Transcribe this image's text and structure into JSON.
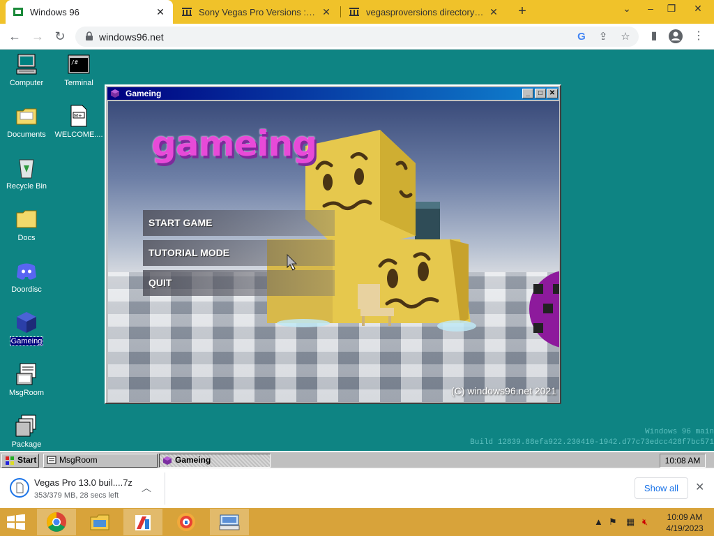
{
  "browser": {
    "tabs": [
      {
        "title": "Windows 96",
        "active": true
      },
      {
        "title": "Sony Vegas Pro Versions : Free Download, Borrow, and Streaming : Internet Archive",
        "active": false
      },
      {
        "title": "vegasproversions directory listing",
        "active": false
      }
    ],
    "new_tab": "+",
    "url": "windows96.net",
    "colors": {
      "tabstrip": "#f0c22a",
      "desktop": "#0e8483"
    }
  },
  "desktop": {
    "icons": [
      {
        "label": "Computer",
        "icon": "computer-icon"
      },
      {
        "label": "Terminal",
        "icon": "terminal-icon"
      },
      {
        "label": "Documents",
        "icon": "folder-documents-icon"
      },
      {
        "label": "WELCOME....",
        "icon": "text-file-icon"
      },
      {
        "label": "Recycle Bin",
        "icon": "recycle-bin-icon"
      },
      {
        "label": "Docs",
        "icon": "folder-icon"
      },
      {
        "label": "Doordisc",
        "icon": "discord-icon"
      },
      {
        "label": "Gameing",
        "icon": "cube-icon",
        "selected": true
      },
      {
        "label": "MsgRoom",
        "icon": "msgroom-icon"
      },
      {
        "label": "Package",
        "icon": "package-icon"
      }
    ],
    "build_line1": "Windows 96 main",
    "build_line2": "Build 12839.88efa922.230410-1942.d77c73edcc428f7bc571"
  },
  "window": {
    "title": "Gameing",
    "game": {
      "title": "gameing",
      "menu": [
        "START GAME",
        "TUTORIAL MODE",
        "QUIT"
      ],
      "copyright": "(C) windows96.net 2021"
    }
  },
  "taskbar": {
    "start": "Start",
    "items": [
      {
        "label": "MsgRoom",
        "pressed": false
      },
      {
        "label": "Gameing",
        "pressed": true
      }
    ],
    "clock": "10:08 AM"
  },
  "download": {
    "filename": "Vegas Pro 13.0 buil....7z",
    "status": "353/379 MB, 28 secs left",
    "show_all": "Show all"
  },
  "os_taskbar": {
    "time": "10:09 AM",
    "date": "4/19/2023"
  }
}
